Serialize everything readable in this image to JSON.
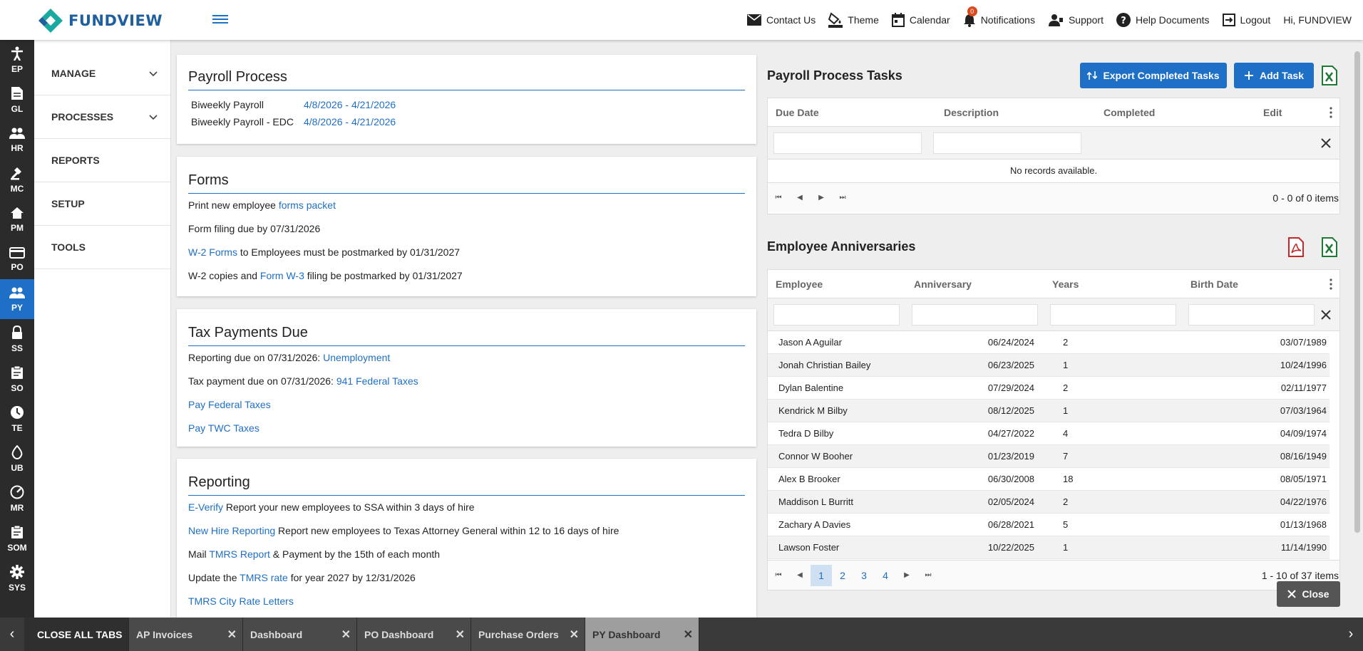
{
  "brand": {
    "name": "FUNDVIEW"
  },
  "topnav": {
    "contact": "Contact Us",
    "theme": "Theme",
    "calendar": "Calendar",
    "notifications": "Notifications",
    "notif_count": "0",
    "support": "Support",
    "help": "Help Documents",
    "logout": "Logout",
    "greeting": "Hi, FUNDVIEW"
  },
  "rail": {
    "items": [
      {
        "label": "EP",
        "icon": "person-icon"
      },
      {
        "label": "GL",
        "icon": "document-icon"
      },
      {
        "label": "HR",
        "icon": "people-icon"
      },
      {
        "label": "MC",
        "icon": "gavel-icon"
      },
      {
        "label": "PM",
        "icon": "home-icon"
      },
      {
        "label": "PO",
        "icon": "card-icon"
      },
      {
        "label": "PY",
        "icon": "group-icon"
      },
      {
        "label": "SS",
        "icon": "lock-icon"
      },
      {
        "label": "SO",
        "icon": "clipboard-icon"
      },
      {
        "label": "TE",
        "icon": "clock-icon"
      },
      {
        "label": "UB",
        "icon": "drop-icon"
      },
      {
        "label": "MR",
        "icon": "gauge-icon"
      },
      {
        "label": "SOM",
        "icon": "clipboard-icon"
      },
      {
        "label": "SYS",
        "icon": "gear-icon"
      }
    ],
    "active": "PY"
  },
  "sidemenu": {
    "manage": "MANAGE",
    "processes": "PROCESSES",
    "reports": "REPORTS",
    "setup": "SETUP",
    "tools": "TOOLS"
  },
  "payroll_process": {
    "title": "Payroll Process",
    "rows": [
      {
        "name": "Biweekly Payroll",
        "range": "4/8/2026 - 4/21/2026"
      },
      {
        "name": "Biweekly Payroll - EDC",
        "range": "4/8/2026 - 4/21/2026"
      }
    ]
  },
  "forms": {
    "title": "Forms",
    "l1_pre": "Print new employee ",
    "l1_link": "forms packet",
    "l2": "Form filing due by 07/31/2026",
    "l3_link": "W-2 Forms",
    "l3_post": " to Employees must be postmarked by 01/31/2027",
    "l4_pre": "W-2 copies and ",
    "l4_link": "Form W-3",
    "l4_post": " filing be postmarked by 01/31/2027"
  },
  "tax": {
    "title": "Tax Payments Due",
    "l1_pre": "Reporting due on 07/31/2026: ",
    "l1_link": "Unemployment",
    "l2_pre": "Tax payment due on 07/31/2026: ",
    "l2_link": "941 Federal Taxes",
    "l3_link": "Pay Federal Taxes",
    "l4_link": "Pay TWC Taxes"
  },
  "reporting": {
    "title": "Reporting",
    "l1_link": "E-Verify",
    "l1_post": " Report your new employees to SSA within 3 days of hire",
    "l2_link": "New Hire Reporting",
    "l2_post": " Report new employees to Texas Attorney General within 12 to 16 days of hire",
    "l3_pre": "Mail ",
    "l3_link": "TMRS Report",
    "l3_post": " & Payment by the 15th of each month",
    "l4_pre": "Update the ",
    "l4_link": "TMRS rate",
    "l4_post": " for year 2027 by 12/31/2026",
    "l5_link": "TMRS City Rate Letters"
  },
  "tasks": {
    "title": "Payroll Process Tasks",
    "export_btn": "Export Completed Tasks",
    "add_btn": "Add Task",
    "cols": [
      "Due Date",
      "Description",
      "Completed",
      "Edit"
    ],
    "empty": "No records available.",
    "pager_info": "0 - 0 of 0 items"
  },
  "anniv": {
    "title": "Employee Anniversaries",
    "cols": [
      "Employee",
      "Anniversary",
      "Years",
      "Birth Date"
    ],
    "rows": [
      [
        "Jason A Aguilar",
        "06/24/2024",
        "2",
        "03/07/1989"
      ],
      [
        "Jonah Christian Bailey",
        "06/23/2025",
        "1",
        "10/24/1996"
      ],
      [
        "Dylan Balentine",
        "07/29/2024",
        "2",
        "02/11/1977"
      ],
      [
        "Kendrick M Bilby",
        "08/12/2025",
        "1",
        "07/03/1964"
      ],
      [
        "Tedra D Bilby",
        "04/27/2022",
        "4",
        "04/09/1974"
      ],
      [
        "Connor W Booher",
        "01/23/2019",
        "7",
        "08/16/1949"
      ],
      [
        "Alex B Brooker",
        "06/30/2008",
        "18",
        "08/05/1971"
      ],
      [
        "Maddison L Burritt",
        "02/05/2024",
        "2",
        "04/22/1976"
      ],
      [
        "Zachary A Davies",
        "06/28/2021",
        "5",
        "01/13/1968"
      ],
      [
        "Lawson Foster",
        "10/22/2025",
        "1",
        "11/14/1990"
      ]
    ],
    "pages": [
      "1",
      "2",
      "3",
      "4"
    ],
    "current_page": "1",
    "pager_info": "1 - 10 of 37 items"
  },
  "close_btn": "Close",
  "tabbar": {
    "close_all": "CLOSE ALL TABS",
    "tabs": [
      "AP Invoices",
      "Dashboard",
      "PO Dashboard",
      "Purchase Orders",
      "PY Dashboard"
    ],
    "active": "PY Dashboard"
  },
  "colors": {
    "accent": "#1e6fc6",
    "rail": "#2b2b2b",
    "excel": "#1d7a35",
    "pdf": "#c62828"
  }
}
